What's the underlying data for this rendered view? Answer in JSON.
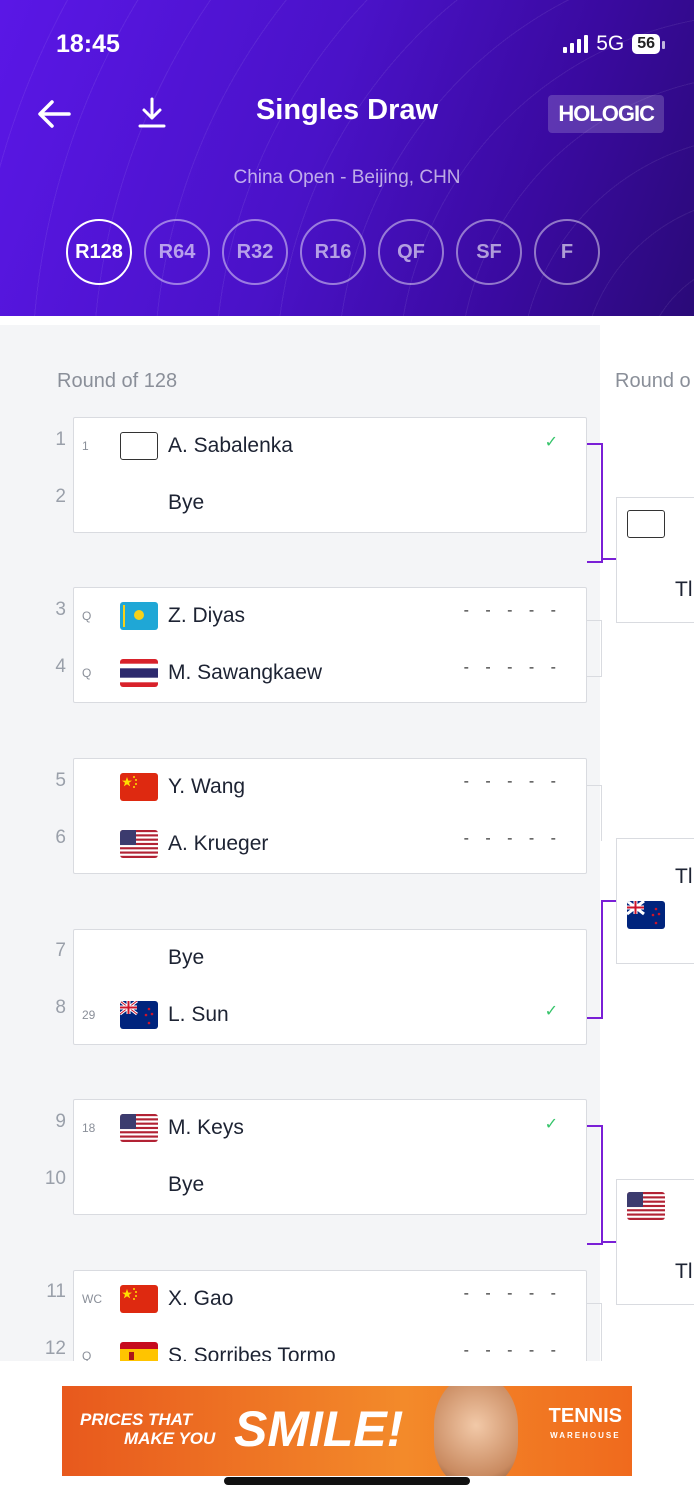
{
  "status_bar": {
    "time": "18:45",
    "network": "5G",
    "battery": "56"
  },
  "header": {
    "title": "Singles Draw",
    "sponsor": "HOLOGIC",
    "subtitle": "China Open - Beijing, CHN",
    "rounds": [
      "R128",
      "R64",
      "R32",
      "R16",
      "QF",
      "SF",
      "F"
    ],
    "active_round": "R128"
  },
  "columns": [
    "Round of 128",
    "Round o"
  ],
  "draw": {
    "seed_numbers": [
      "1",
      "2",
      "3",
      "4",
      "5",
      "6",
      "7",
      "8",
      "9",
      "10",
      "11",
      "12"
    ],
    "matches": [
      {
        "p1": {
          "entry": "1",
          "flag": "empty",
          "name": "A. Sabalenka",
          "result": "✓"
        },
        "p2": {
          "entry": "",
          "flag": "",
          "name": "Bye",
          "result": ""
        }
      },
      {
        "p1": {
          "entry": "Q",
          "flag": "kz",
          "name": "Z. Diyas",
          "result": "- - - - -"
        },
        "p2": {
          "entry": "Q",
          "flag": "th",
          "name": "M. Sawangkaew",
          "result": "- - - - -"
        }
      },
      {
        "p1": {
          "entry": "",
          "flag": "cn",
          "name": "Y. Wang",
          "result": "- - - - -"
        },
        "p2": {
          "entry": "",
          "flag": "us",
          "name": "A. Krueger",
          "result": "- - - - -"
        }
      },
      {
        "p1": {
          "entry": "",
          "flag": "",
          "name": "Bye",
          "result": ""
        },
        "p2": {
          "entry": "29",
          "flag": "nz",
          "name": "L. Sun",
          "result": "✓"
        }
      },
      {
        "p1": {
          "entry": "18",
          "flag": "us",
          "name": "M. Keys",
          "result": "✓"
        },
        "p2": {
          "entry": "",
          "flag": "",
          "name": "Bye",
          "result": ""
        }
      },
      {
        "p1": {
          "entry": "WC",
          "flag": "cn",
          "name": "X. Gao",
          "result": "- - - - -"
        },
        "p2": {
          "entry": "Q",
          "flag": "es",
          "name": "S. Sorribes Tormo",
          "result": "- - - - -"
        }
      }
    ],
    "next_round_visible_text": [
      "Tl",
      "Tl",
      "Tl"
    ]
  },
  "ad": {
    "line1": "PRICES THAT",
    "line2": "MAKE YOU",
    "headline": "SMILE!",
    "brand": "TENNIS",
    "brand_sub": "WAREHOUSE"
  }
}
